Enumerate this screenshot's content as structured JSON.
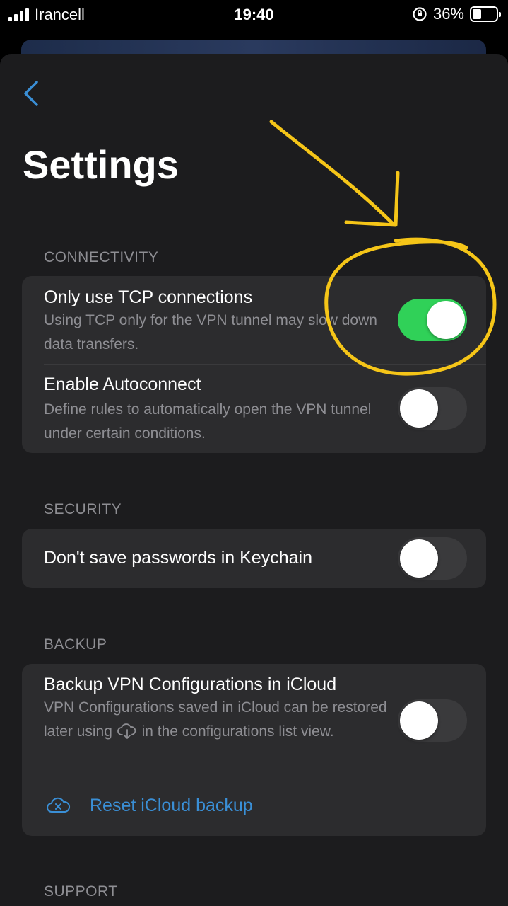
{
  "status_bar": {
    "carrier": "Irancell",
    "time": "19:40",
    "battery_percent": "36%"
  },
  "page": {
    "title": "Settings"
  },
  "sections": {
    "connectivity": {
      "header": "CONNECTIVITY",
      "tcp": {
        "title": "Only use TCP connections",
        "description": "Using TCP only for the VPN tunnel may slow down data transfers.",
        "enabled": true
      },
      "autoconnect": {
        "title": "Enable Autoconnect",
        "description": "Define rules to automatically open the VPN tunnel under certain conditions.",
        "enabled": false
      }
    },
    "security": {
      "header": "SECURITY",
      "keychain": {
        "title": "Don't save passwords in Keychain",
        "enabled": false
      }
    },
    "backup": {
      "header": "BACKUP",
      "icloud": {
        "title": "Backup VPN Configurations in iCloud",
        "description_part1": "VPN Configurations saved in iCloud can be restored later using",
        "description_part2": "in the configurations list view.",
        "enabled": false
      },
      "reset_label": "Reset iCloud backup"
    },
    "support": {
      "header": "SUPPORT"
    }
  },
  "colors": {
    "accent": "#3a8fd6",
    "toggle_on": "#30d158",
    "annotation": "#f5c518"
  }
}
